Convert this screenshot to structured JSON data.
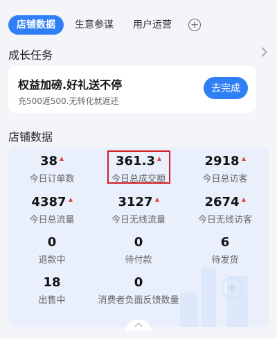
{
  "tabs": [
    {
      "label": "店铺数据",
      "active": true
    },
    {
      "label": "生意参谋",
      "active": false
    },
    {
      "label": "用户运营",
      "active": false
    }
  ],
  "growth": {
    "title": "成长任务",
    "card_title": "权益加磅.好礼送不停",
    "card_subtitle": "充500返500.无转化就返还",
    "button_label": "去完成"
  },
  "store": {
    "title": "店铺数据",
    "stats": [
      {
        "value": "38",
        "label": "今日订单数",
        "up": true
      },
      {
        "value": "361.3",
        "label": "今日总成交额",
        "up": true
      },
      {
        "value": "2918",
        "label": "今日总访客",
        "up": true
      },
      {
        "value": "4387",
        "label": "今日总流量",
        "up": true
      },
      {
        "value": "3127",
        "label": "今日无线流量",
        "up": true
      },
      {
        "value": "2674",
        "label": "今日无线访客",
        "up": true
      },
      {
        "value": "0",
        "label": "退款中",
        "up": false
      },
      {
        "value": "0",
        "label": "待付款",
        "up": false
      },
      {
        "value": "6",
        "label": "待发货",
        "up": false
      },
      {
        "value": "18",
        "label": "出售中",
        "up": false
      },
      {
        "value": "0",
        "label": "消费者负面反馈数量",
        "up": false
      }
    ]
  },
  "colors": {
    "accent": "#2f80f6",
    "up_arrow": "#e0443a",
    "highlight": "#d21f25"
  }
}
